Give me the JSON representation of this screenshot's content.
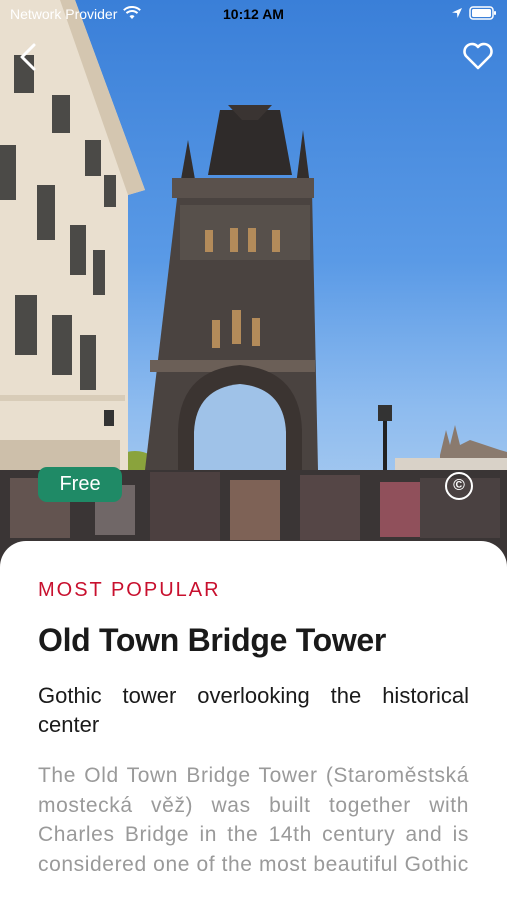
{
  "status_bar": {
    "carrier": "Network Provider",
    "time": "10:12 AM"
  },
  "header": {
    "back_icon": "chevron-left-icon",
    "favorite_icon": "heart-outline-icon"
  },
  "hero": {
    "price_badge": "Free",
    "copyright_symbol": "©",
    "badge_color": "#1f8a66"
  },
  "content": {
    "category": "MOST POPULAR",
    "title": "Old Town Bridge Tower",
    "subtitle": "Gothic tower overlooking the historical center",
    "description": "The Old Town Bridge Tower (Staroměstská mostecká věž) was built together with Charles Bridge in the 14th century and is considered one of the most beautiful Gothic",
    "accent_color": "#c8102e"
  }
}
